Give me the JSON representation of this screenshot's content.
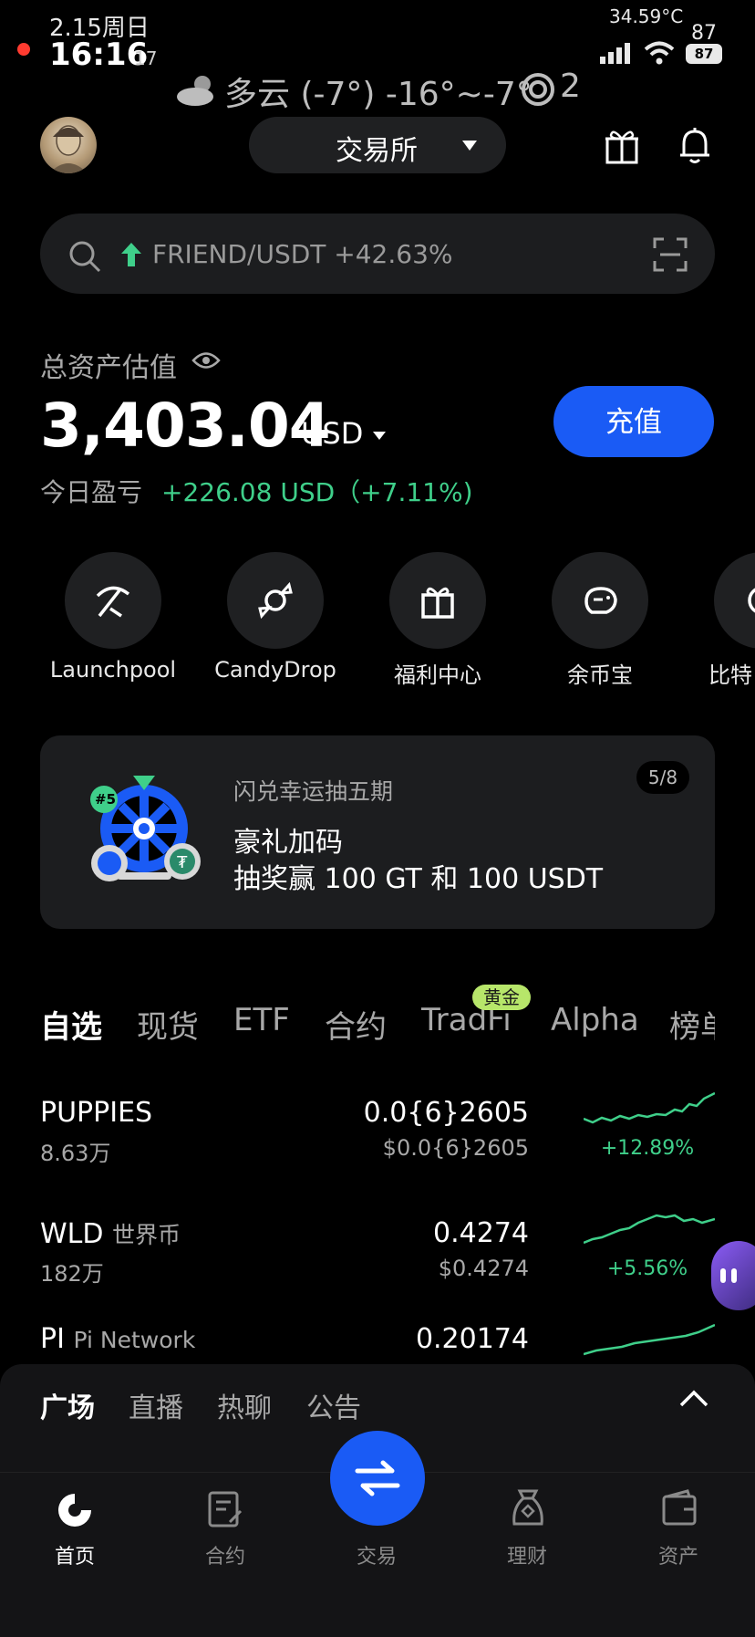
{
  "status_bar": {
    "date": "2.15周日",
    "time": "16:16",
    "seconds": "17",
    "net_speed": "34.59°C",
    "battery_top": "87",
    "battery": "87"
  },
  "weather": "多云 (-7°) -16°~-7°",
  "weather_extra": "2",
  "header": {
    "exchange_label": "交易所"
  },
  "search": {
    "ticker_text": "FRIEND/USDT +42.63%"
  },
  "assets": {
    "title": "总资产估值",
    "value": "3,403.04",
    "currency": "USD",
    "deposit_label": "充值",
    "pnl_label": "今日盈亏",
    "pnl_value": "+226.08 USD（+7.11%)"
  },
  "shortcuts": [
    {
      "label": "Launchpool",
      "icon": "pickaxe-icon"
    },
    {
      "label": "CandyDrop",
      "icon": "candy-icon"
    },
    {
      "label": "福利中心",
      "icon": "gift-icon"
    },
    {
      "label": "余币宝",
      "icon": "piggy-bank-icon"
    },
    {
      "label": "比特",
      "icon": "bitcoin-icon"
    }
  ],
  "banner": {
    "subtitle": "闪兑幸运抽五期",
    "title_line1": "豪礼加码",
    "title_line2": "抽奖赢 100 GT 和 100 USDT",
    "page": "5/8",
    "badge": "#5"
  },
  "market_tabs": [
    "自选",
    "现货",
    "ETF",
    "合约",
    "TradFi",
    "Alpha",
    "榜单"
  ],
  "gold_badge": "黄金",
  "rows": [
    {
      "symbol": "PUPPIES",
      "name": "",
      "volume": "8.63万",
      "price": "0.0{6}2605",
      "price_usd": "$0.0{6}2605",
      "change": "+12.89%"
    },
    {
      "symbol": "WLD",
      "name": "世界币",
      "volume": "182万",
      "price": "0.4274",
      "price_usd": "$0.4274",
      "change": "+5.56%"
    },
    {
      "symbol": "PI",
      "name": "Pi Network",
      "volume": "",
      "price": "0.20174",
      "price_usd": "",
      "change": ""
    }
  ],
  "panel_tabs": [
    "广场",
    "直播",
    "热聊",
    "公告"
  ],
  "nav": [
    {
      "label": "首页",
      "icon": "home-icon"
    },
    {
      "label": "合约",
      "icon": "contract-icon"
    },
    {
      "label": "交易",
      "icon": "swap-icon"
    },
    {
      "label": "理财",
      "icon": "finance-icon"
    },
    {
      "label": "资产",
      "icon": "wallet-icon"
    }
  ],
  "colors": {
    "accent": "#1a5bf5",
    "up": "#3fcf8a",
    "bg": "#000000",
    "card": "#1c1d1f"
  }
}
